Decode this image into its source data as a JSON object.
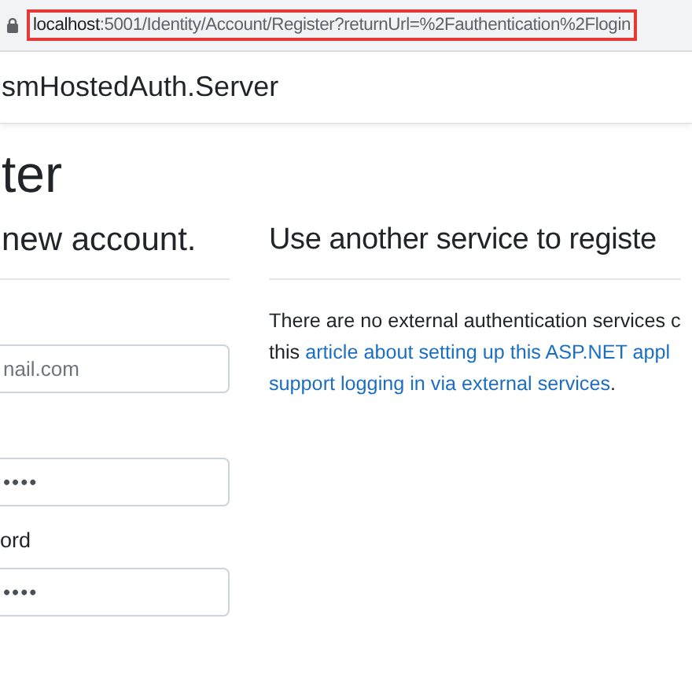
{
  "address_bar": {
    "host": "localhost",
    "path": ":5001/Identity/Account/Register?returnUrl=%2Fauthentication%2Flogin"
  },
  "navbar": {
    "brand": "smHostedAuth.Server"
  },
  "page_title": "ter",
  "form": {
    "heading": "new account.",
    "fields": [
      {
        "kind": "input",
        "placeholder": "nail.com"
      },
      {
        "kind": "input",
        "value": "••••"
      },
      {
        "kind": "label",
        "text": "ord"
      },
      {
        "kind": "input",
        "value": "••••"
      }
    ]
  },
  "external": {
    "heading": "Use another service to registe",
    "lines": [
      [
        {
          "kind": "text",
          "text": "There are no external authentication services c"
        }
      ],
      [
        {
          "kind": "text",
          "text": "this "
        },
        {
          "kind": "link",
          "text": "article about setting up this ASP.NET appl"
        }
      ],
      [
        {
          "kind": "link",
          "text": "support logging in via external services"
        },
        {
          "kind": "text",
          "text": "."
        }
      ]
    ]
  }
}
